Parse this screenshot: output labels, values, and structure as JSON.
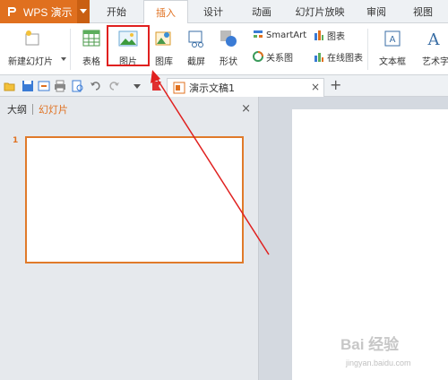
{
  "app": {
    "name": "WPS 演示"
  },
  "tabs": [
    {
      "label": "开始"
    },
    {
      "label": "插入"
    },
    {
      "label": "设计"
    },
    {
      "label": "动画"
    },
    {
      "label": "幻灯片放映"
    },
    {
      "label": "审阅"
    },
    {
      "label": "视图"
    }
  ],
  "ribbon": {
    "new_slide": "新建幻灯片",
    "table": "表格",
    "picture": "图片",
    "gallery": "图库",
    "screenshot": "截屏",
    "shapes": "形状",
    "smartart": "SmartArt",
    "chart": "图表",
    "relation": "关系图",
    "online_chart": "在线图表",
    "textbox": "文本框",
    "wordart": "艺术字"
  },
  "document": {
    "tab_name": "演示文稿1"
  },
  "panel": {
    "outline_label": "大纲",
    "slides_label": "幻灯片",
    "slide_number": "1"
  },
  "watermark": {
    "main": "Bai 经验",
    "sub": "jingyan.baidu.com"
  },
  "colors": {
    "accent": "#e0701f",
    "highlight_box": "#e0201f",
    "arrow": "#e0201f"
  }
}
